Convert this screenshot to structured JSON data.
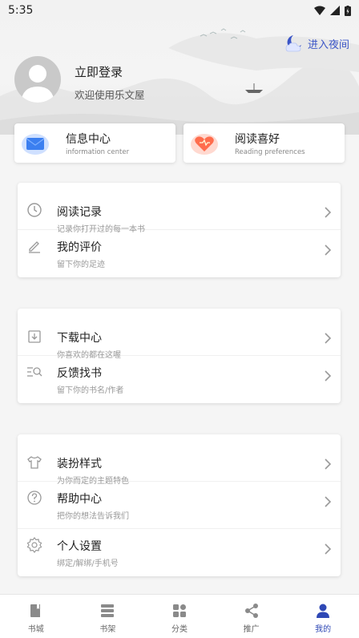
{
  "status_bar": {
    "time": "5:35"
  },
  "header": {
    "night_mode_label": "进入夜间",
    "login_title": "立即登录",
    "login_subtitle": "欢迎使用乐文屋"
  },
  "quick_cards": [
    {
      "title": "信息中心",
      "subtitle": "information center",
      "icon": "message-icon"
    },
    {
      "title": "阅读喜好",
      "subtitle": "Reading preferences",
      "icon": "heart-icon"
    }
  ],
  "groups": [
    {
      "rows": [
        {
          "title": "阅读记录",
          "subtitle": "记录你打开过的每一本书",
          "icon": "clock-icon"
        },
        {
          "title": "我的评价",
          "subtitle": "留下你的足迹",
          "icon": "pencil-icon"
        }
      ]
    },
    {
      "rows": [
        {
          "title": "下载中心",
          "subtitle": "你喜欢的都在这喔",
          "icon": "download-icon"
        },
        {
          "title": "反馈找书",
          "subtitle": "留下你的书名/作者",
          "icon": "search-list-icon"
        }
      ]
    },
    {
      "rows": [
        {
          "title": "装扮样式",
          "subtitle": "为你而定的主题特色",
          "icon": "shirt-icon"
        },
        {
          "title": "帮助中心",
          "subtitle": "把你的想法告诉我们",
          "icon": "question-icon"
        },
        {
          "title": "个人设置",
          "subtitle": "绑定/解绑/手机号",
          "icon": "gear-icon"
        }
      ]
    }
  ],
  "tabs": [
    {
      "label": "书城",
      "icon": "book-icon",
      "active": false
    },
    {
      "label": "书架",
      "icon": "shelf-icon",
      "active": false
    },
    {
      "label": "分类",
      "icon": "category-icon",
      "active": false
    },
    {
      "label": "推广",
      "icon": "share-icon",
      "active": false
    },
    {
      "label": "我的",
      "icon": "user-icon",
      "active": true
    }
  ],
  "colors": {
    "accent": "#2f48b5",
    "night_label": "#3b55c7",
    "inactive_icon": "#8a8a8a"
  }
}
